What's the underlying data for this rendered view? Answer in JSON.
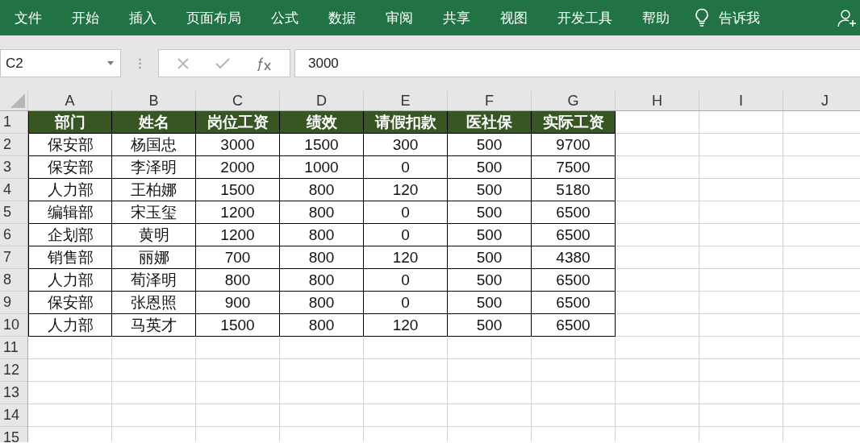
{
  "ribbon": {
    "tabs": [
      "文件",
      "开始",
      "插入",
      "页面布局",
      "公式",
      "数据",
      "审阅",
      "共享",
      "视图",
      "开发工具",
      "帮助"
    ],
    "tell_me": "告诉我"
  },
  "formula_bar": {
    "name_box": "C2",
    "formula": "3000"
  },
  "sheet": {
    "columns": [
      "A",
      "B",
      "C",
      "D",
      "E",
      "F",
      "G",
      "H",
      "I",
      "J"
    ],
    "row_numbers": [
      "1",
      "2",
      "3",
      "4",
      "5",
      "6",
      "7",
      "8",
      "9",
      "10",
      "11",
      "12",
      "13",
      "14",
      "15"
    ],
    "table": {
      "header": [
        "部门",
        "姓名",
        "岗位工资",
        "绩效",
        "请假扣款",
        "医社保",
        "实际工资"
      ],
      "rows": [
        [
          "保安部",
          "杨国忠",
          "3000",
          "1500",
          "300",
          "500",
          "9700"
        ],
        [
          "保安部",
          "李泽明",
          "2000",
          "1000",
          "0",
          "500",
          "7500"
        ],
        [
          "人力部",
          "王柏娜",
          "1500",
          "800",
          "120",
          "500",
          "5180"
        ],
        [
          "编辑部",
          "宋玉玺",
          "1200",
          "800",
          "0",
          "500",
          "6500"
        ],
        [
          "企划部",
          "黄明",
          "1200",
          "800",
          "0",
          "500",
          "6500"
        ],
        [
          "销售部",
          "丽娜",
          "700",
          "800",
          "120",
          "500",
          "4380"
        ],
        [
          "人力部",
          "荀泽明",
          "800",
          "800",
          "0",
          "500",
          "6500"
        ],
        [
          "保安部",
          "张恩照",
          "900",
          "800",
          "0",
          "500",
          "6500"
        ],
        [
          "人力部",
          "马英才",
          "1500",
          "800",
          "120",
          "500",
          "6500"
        ]
      ]
    }
  }
}
